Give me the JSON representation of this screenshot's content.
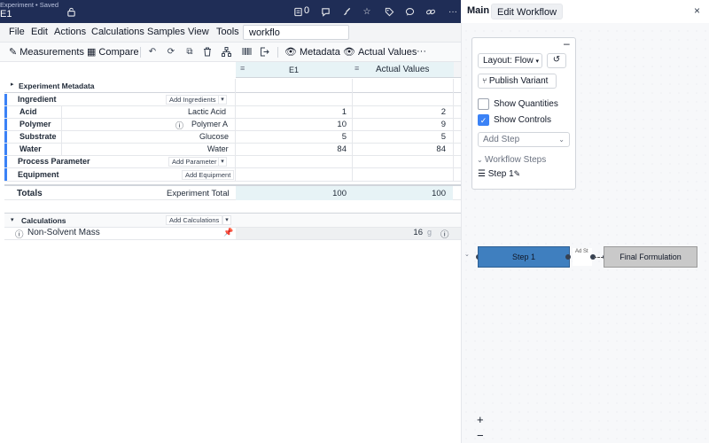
{
  "topbar": {
    "breadcrumb": "Experiment • Saved",
    "doc_title": "E1",
    "notes_count": "0",
    "icons": [
      "lock-icon",
      "notes-icon",
      "chat-bubble-icon",
      "paint-brush-icon",
      "star-icon",
      "tag-icon",
      "comment-icon",
      "link-icon"
    ]
  },
  "menubar": {
    "items": [
      "File",
      "Edit",
      "Actions",
      "Calculations",
      "Samples",
      "View",
      "Tools"
    ],
    "search_value": "workflo"
  },
  "toolbar": {
    "measurements": "Measurements",
    "compare": "Compare",
    "metadata": "Metadata",
    "actual_values": "Actual Values",
    "more": "···"
  },
  "table": {
    "col_e1": "E1",
    "col_actual": "Actual Values",
    "experiment_metadata": "Experiment Metadata",
    "ingredient_header": "Ingredient",
    "add_ingredients": "Add Ingredients",
    "ingredients": [
      {
        "type": "Acid",
        "name": "Lactic Acid",
        "e1": "1",
        "actual": "2"
      },
      {
        "type": "Polymer",
        "name": "Polymer A",
        "e1": "10",
        "actual": "9"
      },
      {
        "type": "Substrate",
        "name": "Glucose",
        "e1": "5",
        "actual": "5"
      },
      {
        "type": "Water",
        "name": "Water",
        "e1": "84",
        "actual": "84"
      }
    ],
    "process_parameter": "Process Parameter",
    "add_parameter": "Add Parameter",
    "equipment": "Equipment",
    "add_equipment": "Add Equipment",
    "totals_label": "Totals",
    "totals_name": "Experiment Total",
    "totals_e1": "100",
    "totals_actual": "100",
    "calculations": "Calculations",
    "add_calculations": "Add Calculations",
    "non_solvent_mass": "Non-Solvent Mass",
    "nsm_value": "16",
    "nsm_unit": "g"
  },
  "right_panel": {
    "tab_main": "Main",
    "tab_edit": "Edit Workflow",
    "close": "×",
    "layout_label": "Layout: Flow",
    "publish_variant": "Publish Variant",
    "show_quantities": "Show Quantities",
    "show_controls": "Show Controls",
    "show_quantities_checked": false,
    "show_controls_checked": true,
    "add_step": "Add Step",
    "workflow_steps": "Workflow Steps",
    "step1": "Step 1",
    "minimize": "–",
    "node_step1": "Step 1",
    "node_final": "Final Formulation",
    "edge_label": "Ad St",
    "zoom_in": "+",
    "zoom_out": "−"
  }
}
